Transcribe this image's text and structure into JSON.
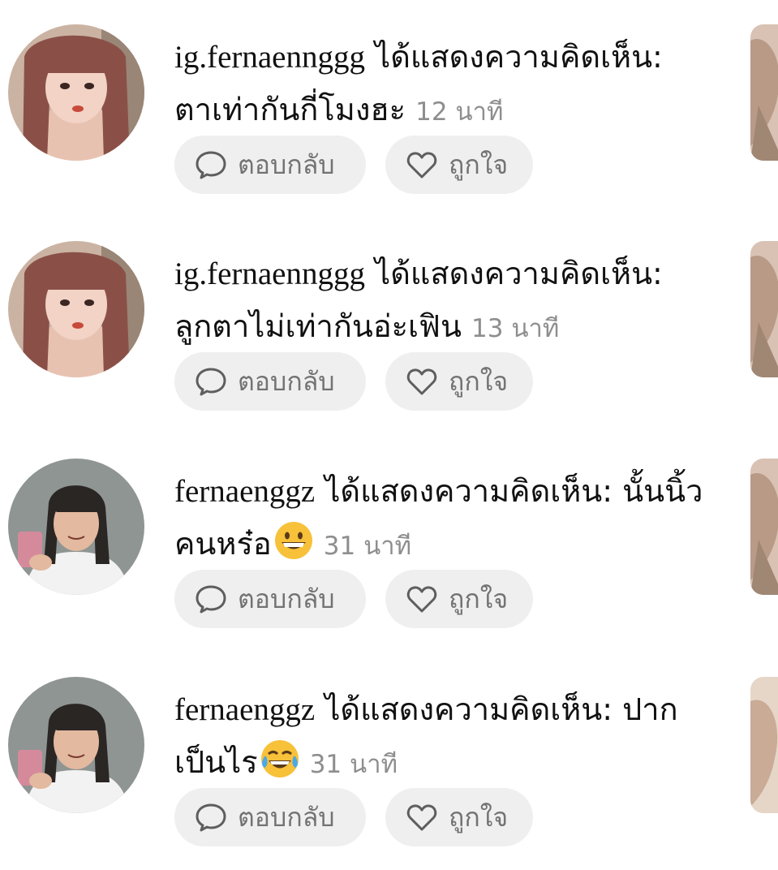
{
  "notifications": [
    {
      "username": "ig.fernaennggg",
      "action": "ได้แสดงความคิดเห็น:",
      "comment": "ตาเท่ากันกี่โมงฮะ",
      "emoji": "",
      "time": "12 นาที",
      "reply_label": "ตอบกลับ",
      "like_label": "ถูกใจ"
    },
    {
      "username": "ig.fernaennggg",
      "action": "ได้แสดงความคิดเห็น:",
      "comment": "ลูกตาไม่เท่ากันอ่ะเฟิน",
      "emoji": "",
      "time": "13 นาที",
      "reply_label": "ตอบกลับ",
      "like_label": "ถูกใจ"
    },
    {
      "username": "fernaenggz",
      "action": "ได้แสดงความคิดเห็น:",
      "comment": "นั้นนิ้วคนหร๋อ",
      "emoji": "grinning-face",
      "time": "31 นาที",
      "reply_label": "ตอบกลับ",
      "like_label": "ถูกใจ"
    },
    {
      "username": "fernaenggz",
      "action": "ได้แสดงความคิดเห็น:",
      "comment": "ปากเป็นไร",
      "emoji": "tears-of-joy-face",
      "time": "31 นาที",
      "reply_label": "ตอบกลับ",
      "like_label": "ถูกใจ"
    }
  ],
  "icons": {
    "reply": "speech-bubble-icon",
    "like": "heart-icon"
  },
  "colors": {
    "pill_bg": "#efefef",
    "pill_text": "#737373",
    "time_text": "#8e8e8e"
  }
}
